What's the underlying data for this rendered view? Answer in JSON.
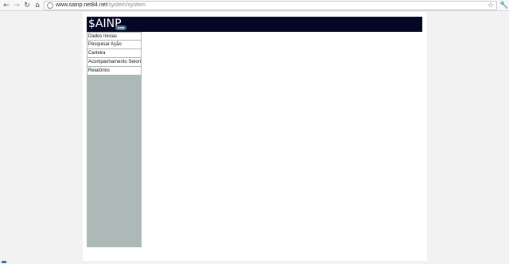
{
  "browser": {
    "url_host": "www.sainp.net84.net",
    "url_path": "/system/system",
    "icons": [
      "back-arrow-icon",
      "forward-arrow-icon",
      "reload-icon",
      "home-icon",
      "page-icon",
      "star-icon",
      "wrench-icon"
    ]
  },
  "header": {
    "logo": "$AINP",
    "badge": "beta",
    "background_color": "#060627"
  },
  "sidebar": {
    "background_color": "#adb9b7",
    "items": [
      {
        "label": "Dados Inicias"
      },
      {
        "label": "Pesquisar Ação"
      },
      {
        "label": "Carteira"
      },
      {
        "label": "Acompanhamento Setorial"
      },
      {
        "label": "Relatórios"
      }
    ]
  }
}
